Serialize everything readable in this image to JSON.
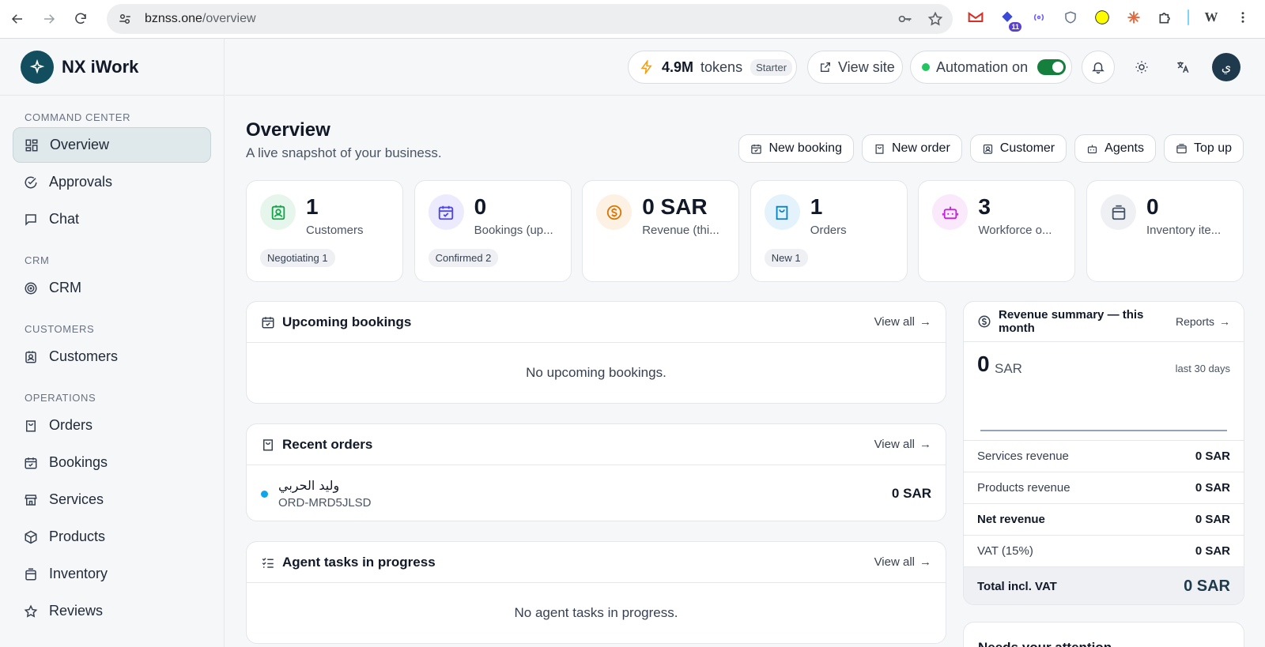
{
  "browser": {
    "url_domain": "bznss.one",
    "url_path": "/overview",
    "extensions": [
      "gmail-icon",
      "teams-icon",
      "podcast-icon",
      "shield-icon",
      "snapchat-icon",
      "claude-icon",
      "puzzle-icon",
      "wordpress-icon"
    ],
    "teams_badge": "11"
  },
  "app": {
    "name": "NX iWork",
    "brand_color": "#134e5e"
  },
  "sidebar": {
    "sections": [
      {
        "label": "COMMAND CENTER",
        "items": [
          {
            "label": "Overview",
            "icon": "grid-icon",
            "active": true
          },
          {
            "label": "Approvals",
            "icon": "check-circle-icon"
          },
          {
            "label": "Chat",
            "icon": "chat-icon"
          }
        ]
      },
      {
        "label": "CRM",
        "items": [
          {
            "label": "CRM",
            "icon": "target-icon"
          }
        ]
      },
      {
        "label": "CUSTOMERS",
        "items": [
          {
            "label": "Customers",
            "icon": "contact-icon"
          }
        ]
      },
      {
        "label": "OPERATIONS",
        "items": [
          {
            "label": "Orders",
            "icon": "bag-icon"
          },
          {
            "label": "Bookings",
            "icon": "calendar-check-icon"
          },
          {
            "label": "Services",
            "icon": "store-icon"
          },
          {
            "label": "Products",
            "icon": "box-icon"
          },
          {
            "label": "Inventory",
            "icon": "archive-icon"
          },
          {
            "label": "Reviews",
            "icon": "star-icon"
          }
        ]
      }
    ]
  },
  "topbar": {
    "tokens_value": "4.9M",
    "tokens_label": "tokens",
    "plan": "Starter",
    "view_site": "View site",
    "automation": "Automation on",
    "automation_enabled": true,
    "avatar_initial": "ي"
  },
  "page": {
    "title": "Overview",
    "subtitle": "A live snapshot of your business.",
    "actions": [
      {
        "label": "New booking",
        "icon": "calendar-check-icon"
      },
      {
        "label": "New order",
        "icon": "bag-icon"
      },
      {
        "label": "Customer",
        "icon": "contact-icon"
      },
      {
        "label": "Agents",
        "icon": "bot-icon"
      },
      {
        "label": "Top up",
        "icon": "wallet-icon"
      }
    ]
  },
  "stats": [
    {
      "value": "1",
      "label": "Customers",
      "tag": "Negotiating 1",
      "icon": "contact-icon",
      "color": "#16a34a",
      "bg": "#e7f6ec"
    },
    {
      "value": "0",
      "label": "Bookings (up...",
      "tag": "Confirmed 2",
      "icon": "calendar-check-icon",
      "color": "#4f46e5",
      "bg": "#ecebfd"
    },
    {
      "value": "0 SAR",
      "label": "Revenue (thi...",
      "tag": "",
      "icon": "dollar-circle-icon",
      "color": "#d97706",
      "bg": "#fdf1e3"
    },
    {
      "value": "1",
      "label": "Orders",
      "tag": "New 1",
      "icon": "bag-icon",
      "color": "#0284c7",
      "bg": "#e4f2fb"
    },
    {
      "value": "3",
      "label": "Workforce o...",
      "tag": "",
      "icon": "bot-icon",
      "color": "#c026d3",
      "bg": "#fae8fb"
    },
    {
      "value": "0",
      "label": "Inventory ite...",
      "tag": "",
      "icon": "archive-icon",
      "color": "#475569",
      "bg": "#eef0f3"
    }
  ],
  "upcoming_bookings": {
    "title": "Upcoming bookings",
    "view_all": "View all",
    "empty": "No upcoming bookings."
  },
  "recent_orders": {
    "title": "Recent orders",
    "view_all": "View all",
    "rows": [
      {
        "customer": "وليد الحربي",
        "order_id": "ORD-MRD5JLSD",
        "amount": "0 SAR",
        "status_color": "#0ea5e9"
      }
    ]
  },
  "agent_tasks": {
    "title": "Agent tasks in progress",
    "view_all": "View all",
    "empty": "No agent tasks in progress."
  },
  "revenue_summary": {
    "title": "Revenue summary — this month",
    "reports": "Reports",
    "total_value": "0",
    "currency": "SAR",
    "period": "last 30 days",
    "rows": [
      {
        "label": "Services revenue",
        "amount": "0 SAR"
      },
      {
        "label": "Products revenue",
        "amount": "0 SAR"
      },
      {
        "label": "Net revenue",
        "amount": "0 SAR"
      },
      {
        "label": "VAT (15%)",
        "amount": "0 SAR"
      }
    ],
    "total_label": "Total incl. VAT",
    "total_amount": "0 SAR"
  },
  "needs_attention": {
    "title": "Needs your attention"
  }
}
